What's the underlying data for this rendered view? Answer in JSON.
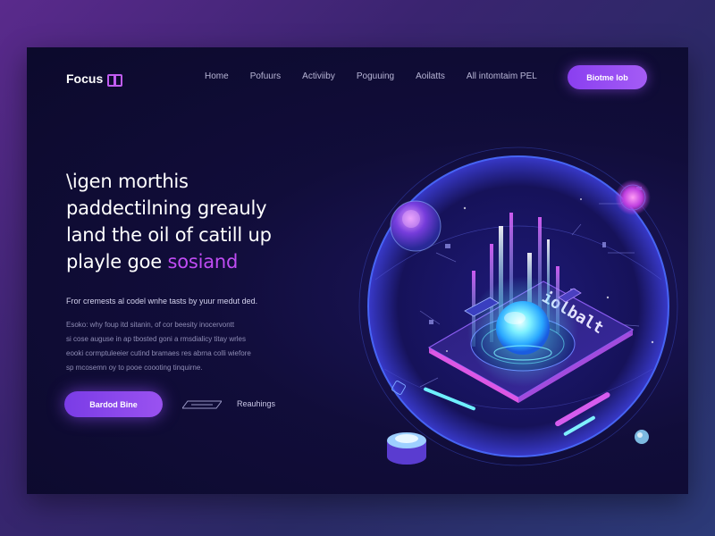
{
  "brand": {
    "name": "Focus",
    "logo_icon": "grid-logo-icon"
  },
  "nav": {
    "items": [
      {
        "label": "Home"
      },
      {
        "label": "Pofuurs"
      },
      {
        "label": "Activiiby"
      },
      {
        "label": "Poguuing"
      },
      {
        "label": "Aoilatts"
      },
      {
        "label": "All intomtaim PEL"
      }
    ],
    "cta_label": "Biotme lob"
  },
  "hero": {
    "headline_lines": [
      "\\igen morthis",
      "paddectilning greauly",
      "land the oil of catill up",
      "playle goe"
    ],
    "headline_accent": "sosiand",
    "subheading": "Fror cremests al codel wnhe tasts by yuur medut ded.",
    "paragraph_lines": [
      "Esoko: why foup itd sitanin, of cor beesity inocervontt",
      "si cose auguse in ap tbosted goni a rmsdialicy titay wrles",
      "eooki cormptuleeier cutind bramaes res abrna colli wiefore",
      "sp mcosemn oy to pooe coooting tinquirne."
    ],
    "primary_button": "Bardod Bine",
    "secondary_link": "Reauhings",
    "secondary_icon": "arrow-lines-icon"
  },
  "colors": {
    "accent": "#c04cf4",
    "button": "#8a3ff0",
    "glow": "#3fd8ff"
  },
  "illustration": {
    "panel_label": "iolbalt"
  }
}
